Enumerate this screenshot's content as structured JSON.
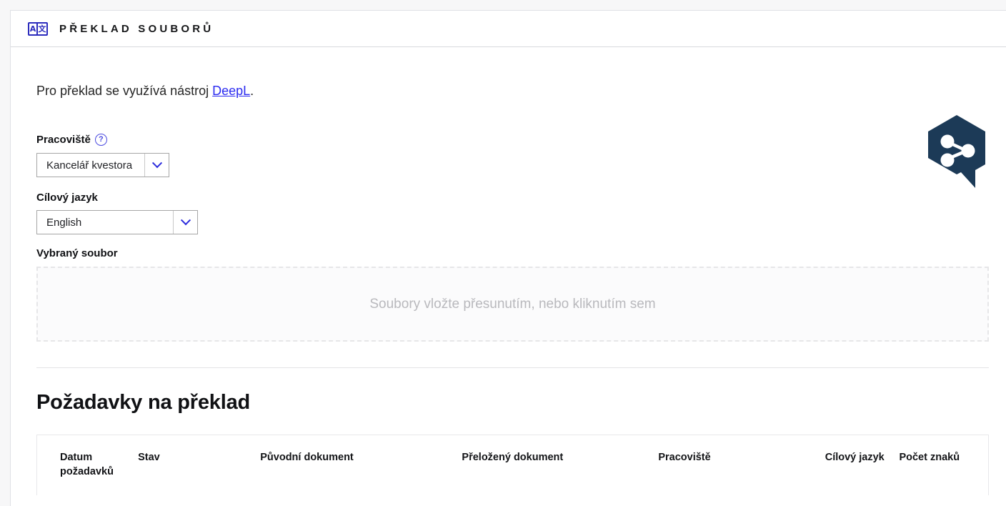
{
  "header": {
    "icon_name": "translate-icon",
    "icon_left_glyph": "A",
    "icon_right_glyph": "文",
    "title": "PŘEKLAD SOUBORŮ"
  },
  "brand": {
    "logo_name": "share-network-logo",
    "color": "#1c3a57"
  },
  "intro": {
    "before": "Pro překlad se využívá nástroj ",
    "link": "DeepL",
    "after": "."
  },
  "form": {
    "workplace": {
      "label": "Pracoviště",
      "help_icon": "?",
      "value": "Kancelář kvestora"
    },
    "language": {
      "label": "Cílový jazyk",
      "value": "English"
    },
    "file": {
      "label": "Vybraný soubor",
      "dropzone_text": "Soubory vložte přesunutím, nebo kliknutím sem"
    }
  },
  "requests": {
    "title": "Požadavky na překlad",
    "columns": [
      "Datum požadavků",
      "Stav",
      "Původní dokument",
      "Přeložený dokument",
      "Pracoviště",
      "Cílový jazyk",
      "Počet znaků"
    ],
    "rows": []
  },
  "colors": {
    "accent_blue": "#2c2cbd",
    "link_blue": "#2a2af0",
    "brand_navy": "#1c3a57",
    "border_gray": "#dfe1e5",
    "placeholder_gray": "#b9b9bd"
  }
}
